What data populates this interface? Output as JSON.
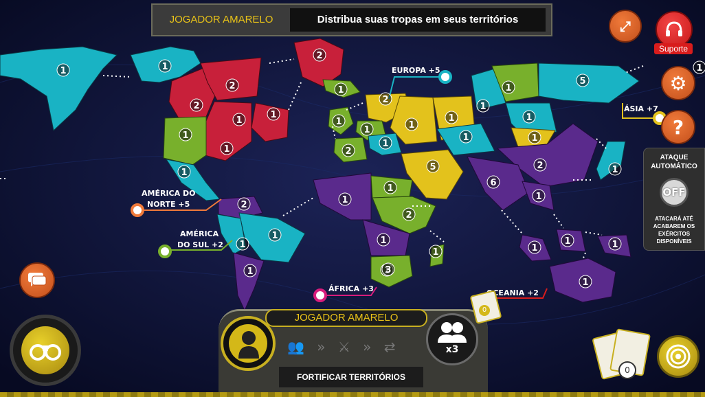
{
  "banner": {
    "player": "JOGADOR AMARELO",
    "message": "Distribua suas tropas em seus territórios"
  },
  "support": {
    "label": "Suporte"
  },
  "colors": {
    "yellow": "#e3c21c",
    "red": "#c8203a",
    "cyan": "#19b3c4",
    "green": "#78b02c",
    "purple": "#5a2a8c"
  },
  "continents": [
    {
      "label": "EUROPA +5"
    },
    {
      "label": "ÁSIA +7"
    },
    {
      "label": "AMÉRICA DO",
      "label2": "NORTE +5"
    },
    {
      "label": "AMÉRICA",
      "label2": "DO SUL +2"
    },
    {
      "label": "ÁFRICA +3"
    },
    {
      "label": "OCEANIA +2"
    }
  ],
  "troops": [
    "1",
    "1",
    "2",
    "2",
    "2",
    "1",
    "1",
    "1",
    "1",
    "1",
    "1",
    "2",
    "1",
    "1",
    "1",
    "1",
    "1",
    "1",
    "5",
    "1",
    "1",
    "2",
    "5",
    "1",
    "1",
    "1",
    "2",
    "6",
    "1",
    "2",
    "1",
    "2",
    "1",
    "1",
    "1",
    "1",
    "1",
    "1",
    "3",
    "1",
    "1",
    "1",
    "1",
    "1",
    "1"
  ],
  "auto_attack": {
    "title1": "ATAQUE",
    "title2": "AUTOMÁTICO",
    "state": "OFF",
    "desc": "ATACARÁ ATÉ ACABAREM OS EXÉRCITOS DISPONÍVEIS"
  },
  "bottom": {
    "player": "JOGADOR AMARELO",
    "phase": "FORTIFICAR TERRITÓRIOS",
    "multiplier": "x3"
  },
  "cards": {
    "count_small": "0",
    "count": "0"
  },
  "icons": [
    "fullscreen-icon",
    "headset-icon",
    "gear-icon",
    "question-icon",
    "chat-icon",
    "binoculars-icon",
    "target-icon",
    "cards-icon",
    "soldier-icon",
    "arrows-icon"
  ]
}
